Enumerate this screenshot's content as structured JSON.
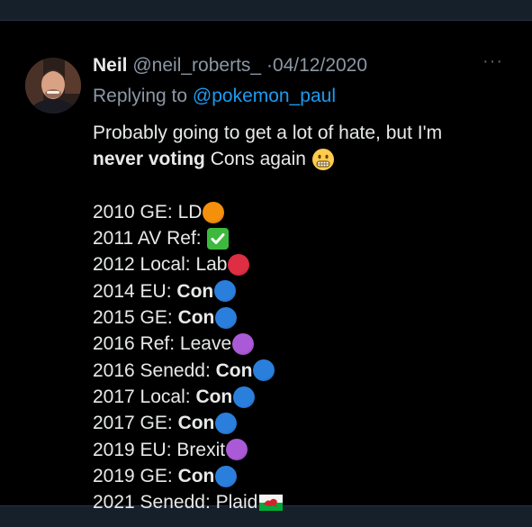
{
  "tweet": {
    "display_name": "Neil",
    "handle": "@neil_roberts_",
    "separator": "·",
    "date": "04/12/2020",
    "more_label": "···",
    "replying_prefix": "Replying to",
    "replying_handle": "@pokemon_paul",
    "text_line1": "Probably going to get a lot of hate, but I'm",
    "text_line2_bold": "never voting",
    "text_line2_rest": " Cons again",
    "votes": [
      {
        "label": "2010 GE: ",
        "value": "LD",
        "bold": false,
        "marker": "orange-circle-icon",
        "color": "#f4900c"
      },
      {
        "label": "2011 AV Ref: ",
        "value": "",
        "bold": false,
        "marker": "check-mark-icon",
        "color": "#3db93d"
      },
      {
        "label": "2012 Local: ",
        "value": "Lab",
        "bold": false,
        "marker": "red-circle-icon",
        "color": "#dd2e44"
      },
      {
        "label": "2014 EU: ",
        "value": "Con",
        "bold": true,
        "marker": "blue-circle-icon",
        "color": "#2b7fdc"
      },
      {
        "label": "2015 GE: ",
        "value": "Con",
        "bold": true,
        "marker": "blue-circle-icon",
        "color": "#2b7fdc"
      },
      {
        "label": "2016 Ref: ",
        "value": "Leave",
        "bold": false,
        "marker": "purple-circle-icon",
        "color": "#aa5ad6"
      },
      {
        "label": "2016 Senedd: ",
        "value": "Con",
        "bold": true,
        "marker": "blue-circle-icon",
        "color": "#2b7fdc"
      },
      {
        "label": "2017 Local: ",
        "value": "Con",
        "bold": true,
        "marker": "blue-circle-icon",
        "color": "#2b7fdc"
      },
      {
        "label": "2017 GE: ",
        "value": "Con",
        "bold": true,
        "marker": "blue-circle-icon",
        "color": "#2b7fdc"
      },
      {
        "label": "2019 EU: ",
        "value": "Brexit",
        "bold": false,
        "marker": "purple-circle-icon",
        "color": "#aa5ad6"
      },
      {
        "label": "2019 GE: ",
        "value": "Con",
        "bold": true,
        "marker": "blue-circle-icon",
        "color": "#2b7fdc"
      },
      {
        "label": "2021 Senedd: ",
        "value": "Plaid",
        "bold": false,
        "marker": "wales-flag-icon",
        "color": "#00ab39"
      }
    ]
  },
  "colors": {
    "page_bg": "#15202b",
    "tweet_bg": "#000000",
    "text": "#e7e9ea",
    "secondary": "#8b98a5",
    "link": "#1d9bf0"
  }
}
